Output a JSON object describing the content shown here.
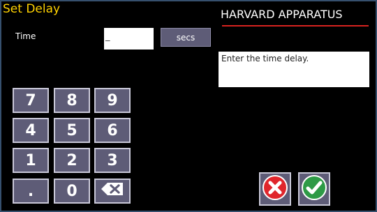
{
  "header": {
    "title": "Set Delay",
    "brand": "HARVARD APPARATUS"
  },
  "form": {
    "time_label": "Time",
    "time_value": "_",
    "unit_label": "secs"
  },
  "message": "Enter the time delay.",
  "keypad": {
    "k7": "7",
    "k8": "8",
    "k9": "9",
    "k4": "4",
    "k5": "5",
    "k6": "6",
    "k1": "1",
    "k2": "2",
    "k3": "3",
    "kdot": ".",
    "k0": "0"
  },
  "colors": {
    "title": "#ffd200",
    "brand_underline": "#d8231f",
    "key_bg": "#5e5c77",
    "cancel": "#e0262c",
    "confirm": "#2e9a46"
  },
  "icons": {
    "backspace": "backspace-icon",
    "cancel": "cancel-x-icon",
    "confirm": "checkmark-icon"
  }
}
